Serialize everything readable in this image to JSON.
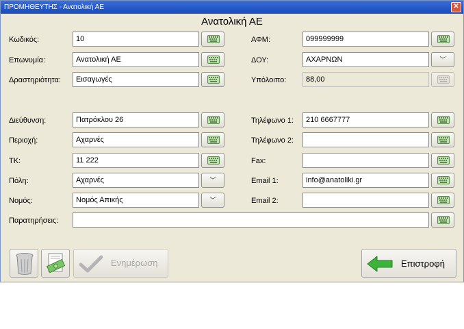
{
  "window": {
    "title": "ΠΡΟΜΗΘΕΥΤΗΣ - Ανατολική ΑΕ"
  },
  "form_title": "Ανατολική ΑΕ",
  "fields": {
    "kodikos": {
      "label": "Κωδικός:",
      "value": "10"
    },
    "eponymia": {
      "label": "Επωνυμία:",
      "value": "Ανατολική ΑΕ"
    },
    "drastiriotita": {
      "label": "Δραστηριότητα:",
      "value": "Εισαγωγές"
    },
    "afm": {
      "label": "ΑΦΜ:",
      "value": "099999999"
    },
    "doy": {
      "label": "ΔΟΥ:",
      "value": "ΑΧΑΡΝΩΝ"
    },
    "ypoloipo": {
      "label": "Υπόλοιπο:",
      "value": "88,00"
    },
    "dieythynsi": {
      "label": "Διεύθυνση:",
      "value": "Πατρόκλου 26"
    },
    "perioxi": {
      "label": "Περιοχή:",
      "value": "Αχαρνές"
    },
    "tk": {
      "label": "ΤΚ:",
      "value": "11 222"
    },
    "poli": {
      "label": "Πόλη:",
      "value": "Αχαρνές"
    },
    "nomos": {
      "label": "Νομός:",
      "value": "Νομός Απικής"
    },
    "tilefono1": {
      "label": "Τηλέφωνο 1:",
      "value": "210 6667777"
    },
    "tilefono2": {
      "label": "Τηλέφωνο 2:",
      "value": ""
    },
    "fax": {
      "label": "Fax:",
      "value": ""
    },
    "email1": {
      "label": "Email 1:",
      "value": "info@anatoliki.gr"
    },
    "email2": {
      "label": "Email 2:",
      "value": ""
    },
    "paratiriseis": {
      "label": "Παρατηρήσεις:",
      "value": ""
    }
  },
  "buttons": {
    "update_label": "Ενημέρωση",
    "return_label": "Επιστροφή"
  },
  "icons": {
    "keyboard": "keyboard-icon",
    "dropdown": "chevron-down-icon",
    "trash": "trash-icon",
    "money": "money-icon",
    "check": "check-icon",
    "back_arrow": "arrow-left-icon"
  },
  "colors": {
    "titlebar": "#2458c8",
    "window_bg": "#ece9d8",
    "arrow_green": "#3cb43c"
  }
}
